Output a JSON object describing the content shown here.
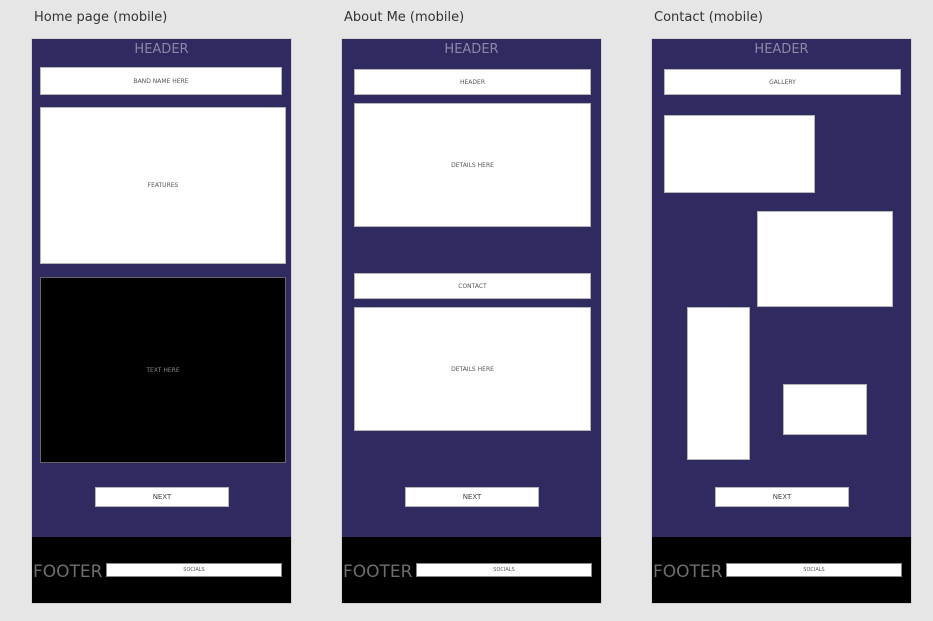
{
  "colors": {
    "canvas_bg": "#e6e6e6",
    "artboard_bg": "#2f2a5f",
    "box_bg": "#ffffff",
    "dark_box_bg": "#000000",
    "footer_bg": "#000000"
  },
  "artboards": [
    {
      "title": "Home page (mobile)",
      "header": "HEADER",
      "boxes": {
        "band_name": "BAND NAME HERE",
        "features": "FEATURES",
        "text": "TEXT HERE"
      },
      "next": "NEXT",
      "footer": "FOOTER",
      "socials": "SOCIALS"
    },
    {
      "title": "About Me (mobile)",
      "header": "HEADER",
      "boxes": {
        "header_box": "HEADER",
        "details_1": "DETAILS HERE",
        "contact": "CONTACT",
        "details_2": "DETAILS HERE"
      },
      "next": "NEXT",
      "footer": "FOOTER",
      "socials": "SOCIALS"
    },
    {
      "title": "Contact (mobile)",
      "header": "HEADER",
      "boxes": {
        "gallery": "GALLERY"
      },
      "next": "NEXT",
      "footer": "FOOTER",
      "socials": "SOCIALS"
    }
  ]
}
